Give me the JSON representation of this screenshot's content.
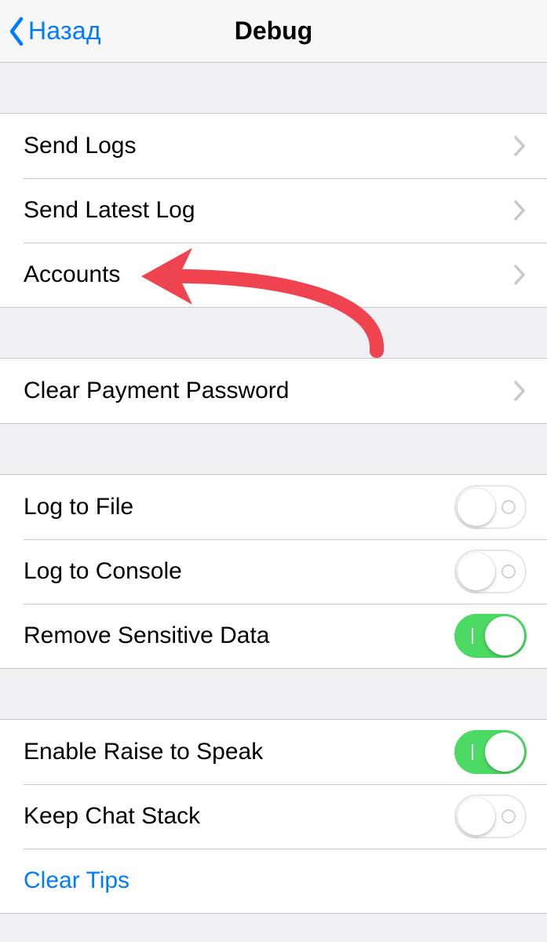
{
  "nav": {
    "back_label": "Назад",
    "title": "Debug"
  },
  "groups": [
    {
      "cells": [
        {
          "key": "send-logs",
          "type": "disclosure",
          "label": "Send Logs"
        },
        {
          "key": "send-latest-log",
          "type": "disclosure",
          "label": "Send Latest Log"
        },
        {
          "key": "accounts",
          "type": "disclosure",
          "label": "Accounts"
        }
      ]
    },
    {
      "cells": [
        {
          "key": "clear-payment-password",
          "type": "disclosure",
          "label": "Clear Payment Password"
        }
      ]
    },
    {
      "cells": [
        {
          "key": "log-to-file",
          "type": "switch",
          "label": "Log to File",
          "value": false
        },
        {
          "key": "log-to-console",
          "type": "switch",
          "label": "Log to Console",
          "value": false
        },
        {
          "key": "remove-sensitive-data",
          "type": "switch",
          "label": "Remove Sensitive Data",
          "value": true
        }
      ]
    },
    {
      "cells": [
        {
          "key": "enable-raise-to-speak",
          "type": "switch",
          "label": "Enable Raise to Speak",
          "value": true
        },
        {
          "key": "keep-chat-stack",
          "type": "switch",
          "label": "Keep Chat Stack",
          "value": false
        },
        {
          "key": "clear-tips",
          "type": "link",
          "label": "Clear Tips"
        }
      ]
    }
  ],
  "annotation": {
    "target_cell_key": "accounts",
    "color": "#ef4450"
  }
}
